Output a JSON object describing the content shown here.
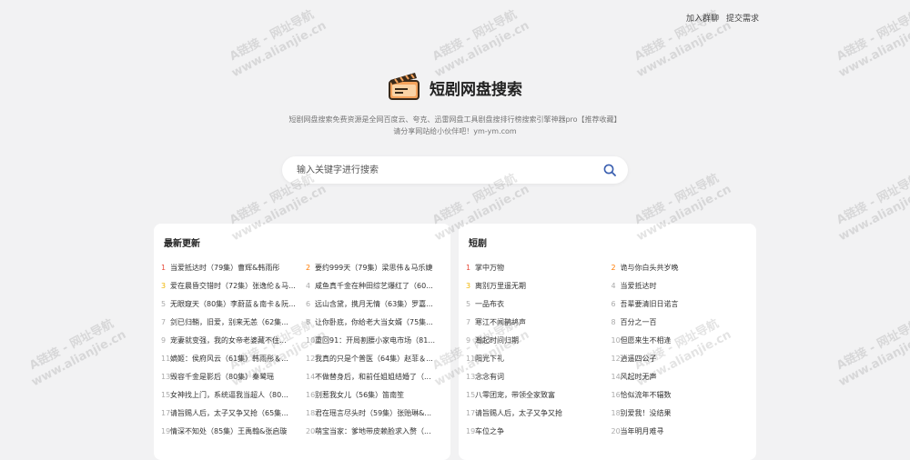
{
  "header": {
    "links": [
      "加入群聊",
      "提交需求"
    ]
  },
  "logo": {
    "title": "短剧网盘搜索",
    "icon": "clapperboard-icon"
  },
  "description": {
    "line1": "短剧网盘搜索免费资源是全网百度云、夸克、迅雷网盘工具剧盘搜排行榜搜索引擎神器pro【推荐收藏】",
    "line2": "请分享网站给小伙伴吧！ym-ym.com"
  },
  "search": {
    "placeholder": "输入关键字进行搜索",
    "icon": "search-icon"
  },
  "latest": {
    "title": "最新更新",
    "items": [
      {
        "n": "1",
        "t": "当爱抵达时（79集）曹辉&韩雨彤"
      },
      {
        "n": "2",
        "t": "要约999天（79集）梁思伟＆马乐婕"
      },
      {
        "n": "3",
        "t": "爱在晨昏交错时（72集）张逸伦＆马..."
      },
      {
        "n": "4",
        "t": "咸鱼真千金在种田综艺爆红了（60..."
      },
      {
        "n": "5",
        "t": "无眼窥天（80集）李蔚蓝＆南卡＆阮..."
      },
      {
        "n": "6",
        "t": "远山含黛，携月无情（63集）罗嘉..."
      },
      {
        "n": "7",
        "t": "剑已归鞘，旧爱，别来无恙（62集..."
      },
      {
        "n": "8",
        "t": "让你卧底，你给老大当女婿（75集..."
      },
      {
        "n": "9",
        "t": "宠妻就变强，我的女帝老婆藏不住..."
      },
      {
        "n": "10",
        "t": "重回91：开局割腰小家电市场（81..."
      },
      {
        "n": "11",
        "t": "嫡姬：侯府风云（61集）韩雨彤＆..."
      },
      {
        "n": "12",
        "t": "我真的只是个普医（64集）赵菲＆..."
      },
      {
        "n": "13",
        "t": "毁容千金是影后（80集）秦鹭瑶"
      },
      {
        "n": "14",
        "t": "不做替身后，和前任姐姐结婚了（..."
      },
      {
        "n": "15",
        "t": "女神找上门，系统逼我当超人（80..."
      },
      {
        "n": "16",
        "t": "别惹我女儿（56集）笛南笙"
      },
      {
        "n": "17",
        "t": "请旨赐人后，太子又争又抢（65集..."
      },
      {
        "n": "18",
        "t": "君在瑶言尽头时（59集）张贻琳&..."
      },
      {
        "n": "19",
        "t": "情深不知处（85集）王禹翰&张启璇"
      },
      {
        "n": "20",
        "t": "萌宝当家：爹地带皮赖脸求入赘（..."
      }
    ]
  },
  "shorts": {
    "title": "短剧",
    "items": [
      {
        "n": "1",
        "t": "掌中万物"
      },
      {
        "n": "2",
        "t": "诡与你白头共岁晚"
      },
      {
        "n": "3",
        "t": "离别万里遥无期"
      },
      {
        "n": "4",
        "t": "当爱抵达时"
      },
      {
        "n": "5",
        "t": "一品布衣"
      },
      {
        "n": "6",
        "t": "吾辈要清旧日诺言"
      },
      {
        "n": "7",
        "t": "寒江不闻鹊鸪声"
      },
      {
        "n": "8",
        "t": "百分之一百"
      },
      {
        "n": "9",
        "t": "瀚起时间归期"
      },
      {
        "n": "10",
        "t": "但愿来生不相逢"
      },
      {
        "n": "11",
        "t": "阳光下礼"
      },
      {
        "n": "12",
        "t": "逍遥四公子"
      },
      {
        "n": "13",
        "t": "念念有词"
      },
      {
        "n": "14",
        "t": "风起时无声"
      },
      {
        "n": "15",
        "t": "八零团宠，带领全家致富"
      },
      {
        "n": "16",
        "t": "恰似流年不辐数"
      },
      {
        "n": "17",
        "t": "请旨赐人后，太子又争又抢"
      },
      {
        "n": "18",
        "t": "别爱我！没结果"
      },
      {
        "n": "19",
        "t": "车位之争"
      },
      {
        "n": "20",
        "t": "当年明月难寻"
      }
    ]
  },
  "watermark": {
    "line1": "A链接 - 网址导航",
    "line2": "www.alianjie.cn"
  },
  "colors": {
    "rank1": "#e74c3c",
    "rank2": "#ff7a00",
    "rank3": "#f0b400",
    "search_icon": "#3a5fb0",
    "logo_orange": "#f5a35c"
  }
}
